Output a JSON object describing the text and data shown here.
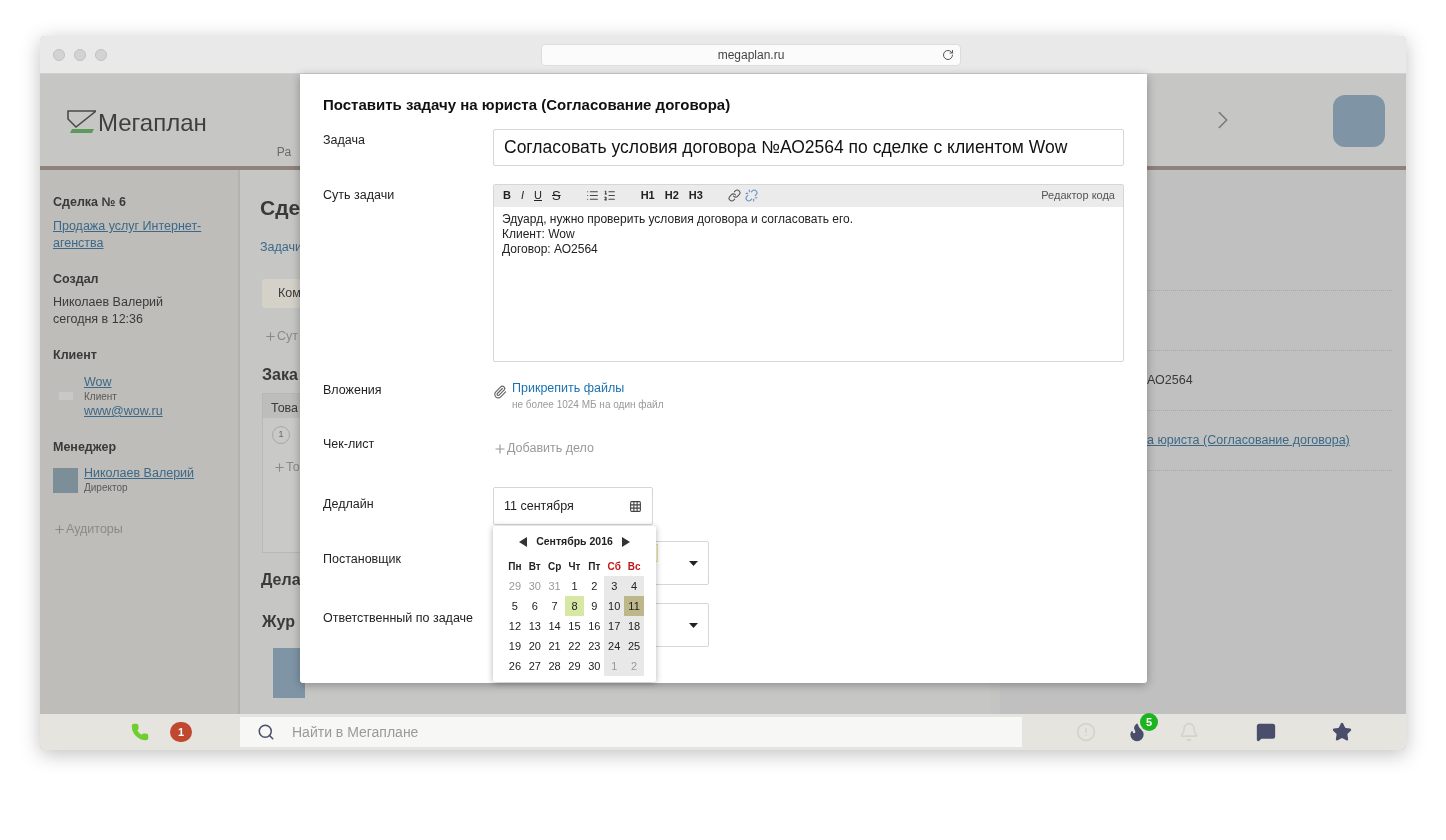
{
  "browser": {
    "url": "megaplan.ru"
  },
  "header": {
    "logo_text": "Мегаплан",
    "nav_fragment": "Ра"
  },
  "sidebar": {
    "deal_title": "Сделка № 6",
    "deal_link": "Продажа услуг Интернет-агенства",
    "creator": {
      "heading": "Создал",
      "name": "Николаев Валерий",
      "time": "сегодня в 12:36"
    },
    "client": {
      "heading": "Клиент",
      "name": "Wow",
      "role": "Клиент",
      "email": "www@wow.ru"
    },
    "manager": {
      "heading": "Менеджер",
      "name": "Николаев Валерий",
      "role": "Директор"
    },
    "add_auditors": "Аудиторы"
  },
  "main": {
    "title": "Сде",
    "tab": "Задачи",
    "button": "Ком",
    "add_field": "Сут",
    "order_heading": "Зака",
    "table_header": "Това",
    "row_number": "1",
    "add_product": "То",
    "deals_heading": "Дела",
    "journal_heading": "Жур"
  },
  "right_panel": {
    "rows": [
      {
        "kind": "empty",
        "text": ""
      },
      {
        "kind": "empty",
        "text": ""
      },
      {
        "kind": "text",
        "text": "АО2564"
      },
      {
        "kind": "link",
        "text": "а юриста (Согласование договора)"
      }
    ]
  },
  "modal": {
    "title": "Поставить задачу на юриста (Согласование договора)",
    "task": {
      "label": "Задача",
      "value": "Согласовать условия договора №АО2564 по сделке с клиентом Wow"
    },
    "description": {
      "label": "Суть задачи",
      "toolbar": [
        [
          {
            "kind": "bold",
            "label": "B"
          },
          {
            "kind": "italic",
            "label": "I"
          },
          {
            "kind": "underline",
            "label": "U"
          },
          {
            "kind": "strike",
            "label": "S"
          }
        ],
        [
          {
            "kind": "bullets"
          },
          {
            "kind": "numbers"
          }
        ],
        [
          {
            "kind": "heading",
            "label": "H1"
          },
          {
            "kind": "heading",
            "label": "H2"
          },
          {
            "kind": "heading",
            "label": "H3"
          }
        ],
        [
          {
            "kind": "link"
          },
          {
            "kind": "unlink"
          }
        ]
      ],
      "code_editor": "Редактор кода",
      "lines": [
        "Эдуард, нужно проверить условия договора и согласовать его.",
        "Клиент: Wow",
        "Договор: АО2564"
      ]
    },
    "attachments": {
      "label": "Вложения",
      "link": "Прикрепить файлы",
      "hint": "не более 1024 МБ на один файл"
    },
    "checklist": {
      "label": "Чек-лист",
      "add": "Добавить дело"
    },
    "deadline": {
      "label": "Дедлайн",
      "value": "11 сентября"
    },
    "assigner": {
      "label": "Постановщик"
    },
    "responsible": {
      "label": "Ответственный по задаче"
    }
  },
  "calendar": {
    "month": "Сентябрь 2016",
    "weekdays": [
      {
        "label": "Пн",
        "weekend": false
      },
      {
        "label": "Вт",
        "weekend": false
      },
      {
        "label": "Ср",
        "weekend": false
      },
      {
        "label": "Чт",
        "weekend": false
      },
      {
        "label": "Пт",
        "weekend": false
      },
      {
        "label": "Сб",
        "weekend": true
      },
      {
        "label": "Вс",
        "weekend": true
      }
    ],
    "weeks": [
      [
        {
          "label": "29",
          "other_month": true,
          "today": false,
          "selected": false
        },
        {
          "label": "30",
          "other_month": true,
          "today": false,
          "selected": false
        },
        {
          "label": "31",
          "other_month": true,
          "today": false,
          "selected": false
        },
        {
          "label": "1",
          "other_month": false,
          "today": false,
          "selected": false
        },
        {
          "label": "2",
          "other_month": false,
          "today": false,
          "selected": false
        },
        {
          "label": "3",
          "other_month": false,
          "today": false,
          "selected": false
        },
        {
          "label": "4",
          "other_month": false,
          "today": false,
          "selected": false
        }
      ],
      [
        {
          "label": "5",
          "other_month": false,
          "today": false,
          "selected": false
        },
        {
          "label": "6",
          "other_month": false,
          "today": false,
          "selected": false
        },
        {
          "label": "7",
          "other_month": false,
          "today": false,
          "selected": false
        },
        {
          "label": "8",
          "other_month": false,
          "today": true,
          "selected": false
        },
        {
          "label": "9",
          "other_month": false,
          "today": false,
          "selected": false
        },
        {
          "label": "10",
          "other_month": false,
          "today": false,
          "selected": false
        },
        {
          "label": "11",
          "other_month": false,
          "today": false,
          "selected": true
        }
      ],
      [
        {
          "label": "12",
          "other_month": false,
          "today": false,
          "selected": false
        },
        {
          "label": "13",
          "other_month": false,
          "today": false,
          "selected": false
        },
        {
          "label": "14",
          "other_month": false,
          "today": false,
          "selected": false
        },
        {
          "label": "15",
          "other_month": false,
          "today": false,
          "selected": false
        },
        {
          "label": "16",
          "other_month": false,
          "today": false,
          "selected": false
        },
        {
          "label": "17",
          "other_month": false,
          "today": false,
          "selected": false
        },
        {
          "label": "18",
          "other_month": false,
          "today": false,
          "selected": false
        }
      ],
      [
        {
          "label": "19",
          "other_month": false,
          "today": false,
          "selected": false
        },
        {
          "label": "20",
          "other_month": false,
          "today": false,
          "selected": false
        },
        {
          "label": "21",
          "other_month": false,
          "today": false,
          "selected": false
        },
        {
          "label": "22",
          "other_month": false,
          "today": false,
          "selected": false
        },
        {
          "label": "23",
          "other_month": false,
          "today": false,
          "selected": false
        },
        {
          "label": "24",
          "other_month": false,
          "today": false,
          "selected": false
        },
        {
          "label": "25",
          "other_month": false,
          "today": false,
          "selected": false
        }
      ],
      [
        {
          "label": "26",
          "other_month": false,
          "today": false,
          "selected": false
        },
        {
          "label": "27",
          "other_month": false,
          "today": false,
          "selected": false
        },
        {
          "label": "28",
          "other_month": false,
          "today": false,
          "selected": false
        },
        {
          "label": "29",
          "other_month": false,
          "today": false,
          "selected": false
        },
        {
          "label": "30",
          "other_month": false,
          "today": false,
          "selected": false
        },
        {
          "label": "1",
          "other_month": true,
          "today": false,
          "selected": false
        },
        {
          "label": "2",
          "other_month": true,
          "today": false,
          "selected": false
        }
      ]
    ]
  },
  "bottom_bar": {
    "call_badge": "1",
    "search_placeholder": "Найти в Мегаплане",
    "icons": [
      {
        "kind": "alert",
        "disabled": true
      },
      {
        "kind": "fire",
        "disabled": false,
        "badge": "5"
      },
      {
        "kind": "bell",
        "disabled": true
      },
      {
        "kind": "chat",
        "disabled": false
      },
      {
        "kind": "star",
        "disabled": false
      }
    ]
  }
}
